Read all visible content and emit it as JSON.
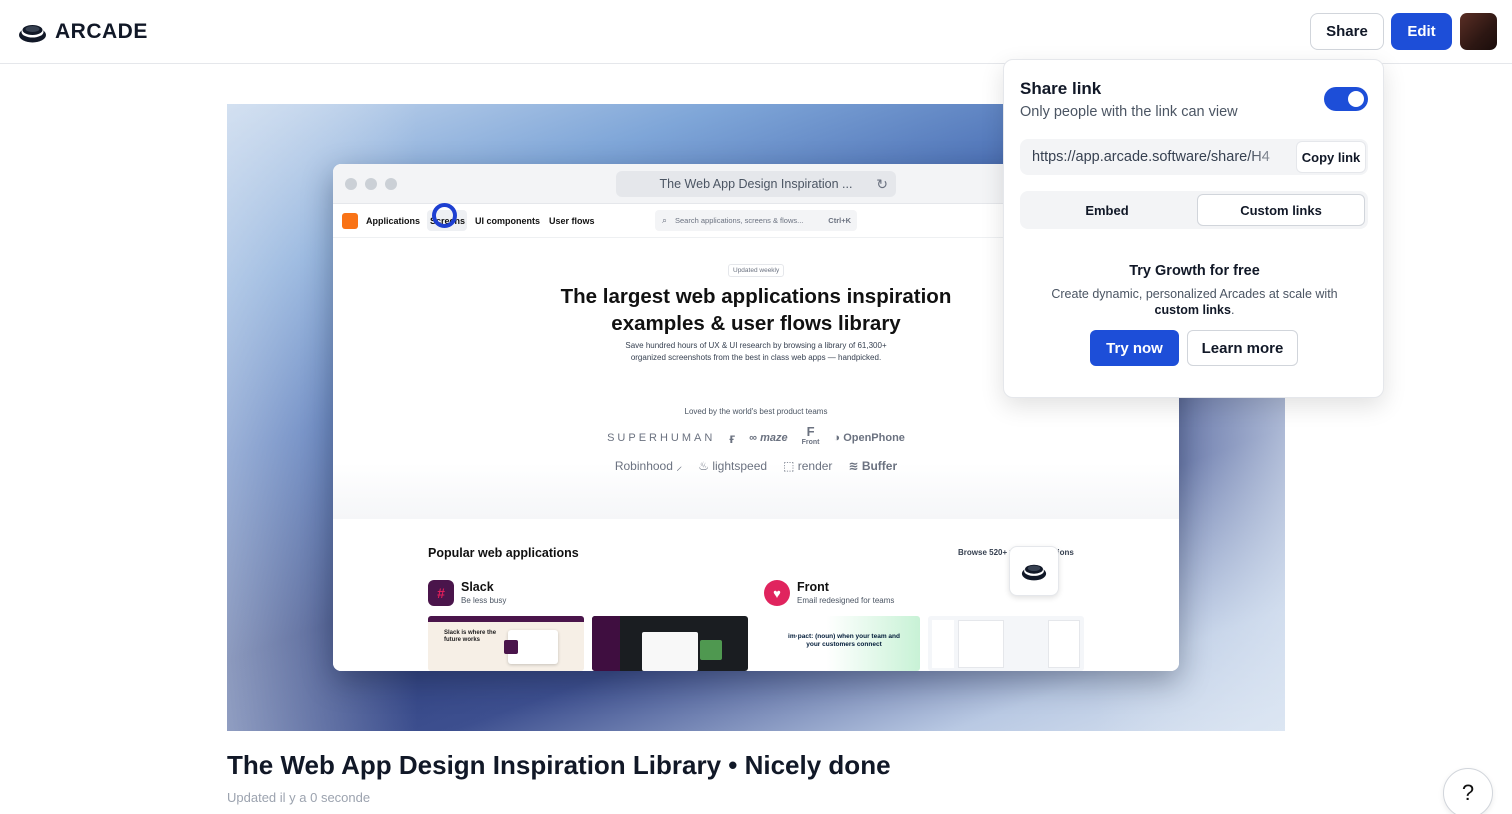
{
  "header": {
    "brand": "ARCADE",
    "share_label": "Share",
    "edit_label": "Edit"
  },
  "preview": {
    "browser_url_title": "The Web App Design Inspiration ...",
    "nav": {
      "applications": "Applications",
      "screens": "Screens",
      "ui_components": "UI components",
      "user_flows": "User flows",
      "search_placeholder": "Search applications, screens & flows...",
      "search_shortcut": "Ctrl+K"
    },
    "hero": {
      "badge": "Updated weekly",
      "heading_line1": "The largest web applications inspiration",
      "heading_line2": "examples & user flows library",
      "sub_line1": "Save hundred hours of UX & UI research by browsing a library of 61,300+",
      "sub_line2": "organized screenshots from the best in class web apps — handpicked.",
      "loved": "Loved by the world's best product teams",
      "logos_row1": [
        "SUPERHUMAN",
        "maze",
        "Front",
        "OpenPhone"
      ],
      "logos_row2": [
        "Robinhood",
        "lightspeed",
        "render",
        "Buffer"
      ]
    },
    "popular": {
      "title": "Popular web applications",
      "browse": "Browse 520+ web applications",
      "apps": [
        {
          "name": "Slack",
          "tagline": "Be less busy"
        },
        {
          "name": "Front",
          "tagline": "Email redesigned for teams"
        }
      ],
      "thumb_slack_text": "Slack is where the future works",
      "thumb_front_text": "im·pact: (noun) when your team and your customers connect"
    }
  },
  "page": {
    "title": "The Web App Design Inspiration Library • Nicely done",
    "updated": "Updated il y a 0 seconde",
    "help": "?"
  },
  "share_popover": {
    "title": "Share link",
    "subtitle": "Only people with the link can view",
    "toggle_on": true,
    "link": "https://app.arcade.software/share/H4",
    "copy_label": "Copy link",
    "tabs": [
      "Embed",
      "Custom links"
    ],
    "active_tab": "Custom links",
    "promo_title": "Try Growth for free",
    "promo_desc": "Create dynamic, personalized Arcades at scale with",
    "promo_bold": "custom links",
    "promo_end": ".",
    "try_label": "Try now",
    "learn_label": "Learn more"
  },
  "colors": {
    "accent": "#1d4ed8",
    "border": "#e5e7eb"
  }
}
